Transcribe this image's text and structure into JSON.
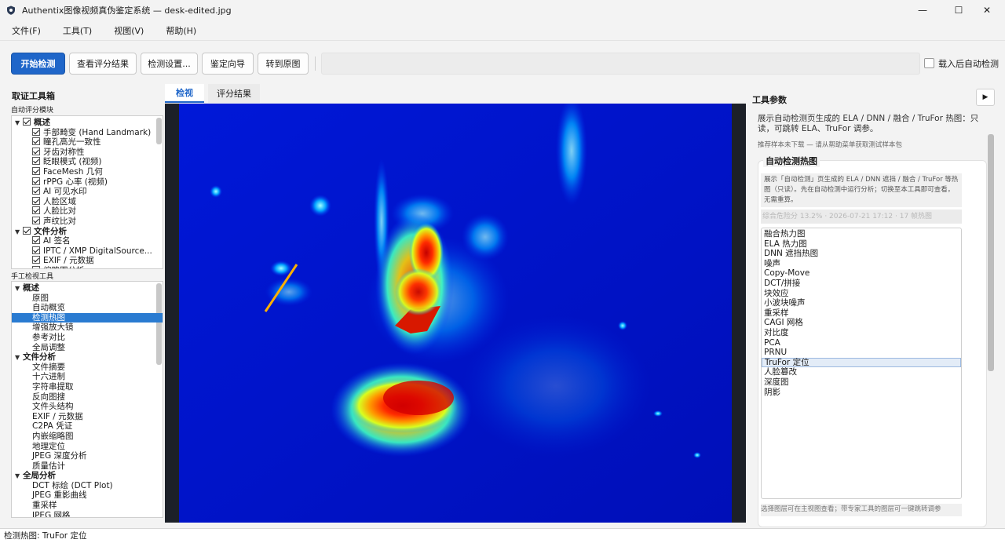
{
  "window": {
    "title": "Authentix图像视频真伪鉴定系统 — desk-edited.jpg",
    "minimize": "—",
    "maximize": "☐",
    "close": "✕"
  },
  "menu": [
    "文件(F)",
    "工具(T)",
    "视图(V)",
    "帮助(H)"
  ],
  "toolbar": {
    "start": "开始检测",
    "view_scores": "查看评分结果",
    "settings": "检测设置...",
    "wizard": "鉴定向导",
    "to_original": "转到原图",
    "auto_detect_label": "载入后自动检测"
  },
  "left": {
    "title": "取证工具箱",
    "auto_label": "自动评分模块",
    "auto_tree": [
      {
        "label": "概述",
        "level": 0,
        "group": true
      },
      {
        "label": "手部畸变 (Hand Landmark)",
        "level": 1
      },
      {
        "label": "瞳孔高光一致性",
        "level": 1
      },
      {
        "label": "牙齿对称性",
        "level": 1
      },
      {
        "label": "眨眼模式 (视频)",
        "level": 1
      },
      {
        "label": "FaceMesh 几何",
        "level": 1
      },
      {
        "label": "rPPG 心率 (视频)",
        "level": 1
      },
      {
        "label": "AI 可见水印",
        "level": 1
      },
      {
        "label": "人脸区域",
        "level": 1
      },
      {
        "label": "人脸比对",
        "level": 1
      },
      {
        "label": "声纹比对",
        "level": 1
      },
      {
        "label": "文件分析",
        "level": 0,
        "group": true
      },
      {
        "label": "AI 签名",
        "level": 1
      },
      {
        "label": "IPTC / XMP DigitalSource...",
        "level": 1
      },
      {
        "label": "EXIF / 元数据",
        "level": 1
      },
      {
        "label": "缩略图分析",
        "level": 1
      }
    ],
    "manual_label": "手工检视工具",
    "manual_tree": [
      {
        "label": "概述",
        "level": 0
      },
      {
        "label": "原图",
        "level": 1
      },
      {
        "label": "自动概览",
        "level": 1
      },
      {
        "label": "检测热图",
        "level": 1,
        "selected": true
      },
      {
        "label": "增强放大镜",
        "level": 1
      },
      {
        "label": "参考对比",
        "level": 1
      },
      {
        "label": "全局调整",
        "level": 1
      },
      {
        "label": "文件分析",
        "level": 0
      },
      {
        "label": "文件摘要",
        "level": 1
      },
      {
        "label": "十六进制",
        "level": 1
      },
      {
        "label": "字符串提取",
        "level": 1
      },
      {
        "label": "反向图搜",
        "level": 1
      },
      {
        "label": "文件头结构",
        "level": 1
      },
      {
        "label": "EXIF / 元数据",
        "level": 1
      },
      {
        "label": "C2PA 凭证",
        "level": 1
      },
      {
        "label": "内嵌缩略图",
        "level": 1
      },
      {
        "label": "地理定位",
        "level": 1
      },
      {
        "label": "JPEG 深度分析",
        "level": 1
      },
      {
        "label": "质量估计",
        "level": 1
      },
      {
        "label": "全局分析",
        "level": 0
      },
      {
        "label": "DCT 标绘 (DCT Plot)",
        "level": 1
      },
      {
        "label": "JPEG 重影曲线",
        "level": 1
      },
      {
        "label": "重采样",
        "level": 1
      },
      {
        "label": "JPEG 网格",
        "level": 1
      }
    ]
  },
  "center": {
    "tabs": [
      "检视",
      "评分结果"
    ]
  },
  "right": {
    "title": "工具参数",
    "expand": "▶",
    "desc": "展示自动检测页生成的 ELA / DNN / 融合 / TruFor 热图：只读，可跳转 ELA、TruFor 调参。",
    "hint": "推荐样本未下载 — 请从帮助菜单获取测试样本包",
    "card_title": "自动检测热图",
    "note": "展示「自动检测」页生成的 ELA / DNN 遮挡 / 融合 / TruFor 等热图（只读）。先在自动检测中运行分析；切换至本工具即可查看，无需重算。",
    "score_line": "综合危险分 13.2% · 2026-07-21 17:12 · 17 帧热图",
    "list": [
      "融合热力图",
      "ELA 热力图",
      "DNN 遮挡热图",
      "噪声",
      "Copy-Move",
      "DCT/拼接",
      "块效应",
      "小波块噪声",
      "重采样",
      "CAGI 网格",
      "对比度",
      "PCA",
      "PRNU",
      "TruFor 定位",
      "人脸篡改",
      "深度图",
      "阴影"
    ],
    "selected_index": 13,
    "footer": "选择图层可在主视图查看；带专家工具的图层可一键跳转调参"
  },
  "status": "检测热图: TruFor 定位",
  "colors": {
    "accent": "#1f66c9",
    "selection": "#2a7bd1"
  }
}
